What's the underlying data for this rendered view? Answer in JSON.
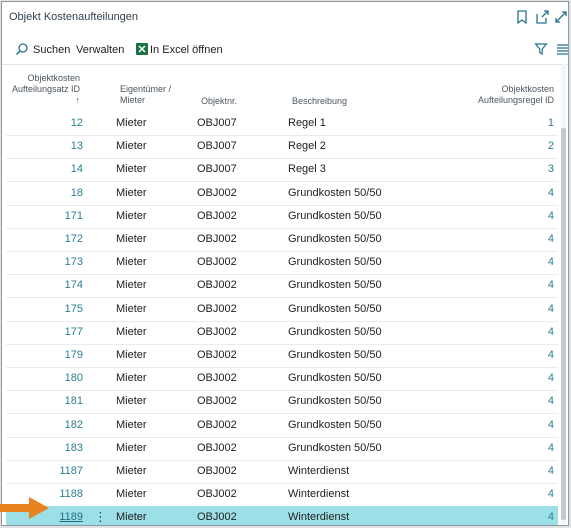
{
  "window": {
    "title": "Objekt Kostenaufteilungen"
  },
  "actions": {
    "search": "Suchen",
    "manage": "Verwalten",
    "excel": "In Excel öffnen"
  },
  "columns": {
    "id_line1": "Objektkosten",
    "id_line2": "Aufteilungsatz ID",
    "id_sort": "↑",
    "owner_line1": "Eigentümer /",
    "owner_line2": "Mieter",
    "objnr": "Objektnr.",
    "desc": "Beschreibung",
    "rule_line1": "Objektkosten",
    "rule_line2": "Aufteilungsregel ID"
  },
  "rows": [
    {
      "id": "12",
      "owner": "Mieter",
      "obj": "OBJ007",
      "desc": "Regel 1",
      "rule": "1"
    },
    {
      "id": "13",
      "owner": "Mieter",
      "obj": "OBJ007",
      "desc": "Regel 2",
      "rule": "2"
    },
    {
      "id": "14",
      "owner": "Mieter",
      "obj": "OBJ007",
      "desc": "Regel 3",
      "rule": "3"
    },
    {
      "id": "18",
      "owner": "Mieter",
      "obj": "OBJ002",
      "desc": "Grundkosten 50/50",
      "rule": "4"
    },
    {
      "id": "171",
      "owner": "Mieter",
      "obj": "OBJ002",
      "desc": "Grundkosten 50/50",
      "rule": "4"
    },
    {
      "id": "172",
      "owner": "Mieter",
      "obj": "OBJ002",
      "desc": "Grundkosten 50/50",
      "rule": "4"
    },
    {
      "id": "173",
      "owner": "Mieter",
      "obj": "OBJ002",
      "desc": "Grundkosten 50/50",
      "rule": "4"
    },
    {
      "id": "174",
      "owner": "Mieter",
      "obj": "OBJ002",
      "desc": "Grundkosten 50/50",
      "rule": "4"
    },
    {
      "id": "175",
      "owner": "Mieter",
      "obj": "OBJ002",
      "desc": "Grundkosten 50/50",
      "rule": "4"
    },
    {
      "id": "177",
      "owner": "Mieter",
      "obj": "OBJ002",
      "desc": "Grundkosten 50/50",
      "rule": "4"
    },
    {
      "id": "179",
      "owner": "Mieter",
      "obj": "OBJ002",
      "desc": "Grundkosten 50/50",
      "rule": "4"
    },
    {
      "id": "180",
      "owner": "Mieter",
      "obj": "OBJ002",
      "desc": "Grundkosten 50/50",
      "rule": "4"
    },
    {
      "id": "181",
      "owner": "Mieter",
      "obj": "OBJ002",
      "desc": "Grundkosten 50/50",
      "rule": "4"
    },
    {
      "id": "182",
      "owner": "Mieter",
      "obj": "OBJ002",
      "desc": "Grundkosten 50/50",
      "rule": "4"
    },
    {
      "id": "183",
      "owner": "Mieter",
      "obj": "OBJ002",
      "desc": "Grundkosten 50/50",
      "rule": "4"
    },
    {
      "id": "1187",
      "owner": "Mieter",
      "obj": "OBJ002",
      "desc": "Winterdienst",
      "rule": "4"
    },
    {
      "id": "1188",
      "owner": "Mieter",
      "obj": "OBJ002",
      "desc": "Winterdienst",
      "rule": "4"
    },
    {
      "id": "1189",
      "owner": "Mieter",
      "obj": "OBJ002",
      "desc": "Winterdienst",
      "rule": "4",
      "selected": true
    }
  ],
  "row_menu": "⋮",
  "colors": {
    "accent": "#26738c",
    "selected_row": "#9cdfe6",
    "arrow": "#e8831f",
    "excel_green": "#1d7245"
  }
}
